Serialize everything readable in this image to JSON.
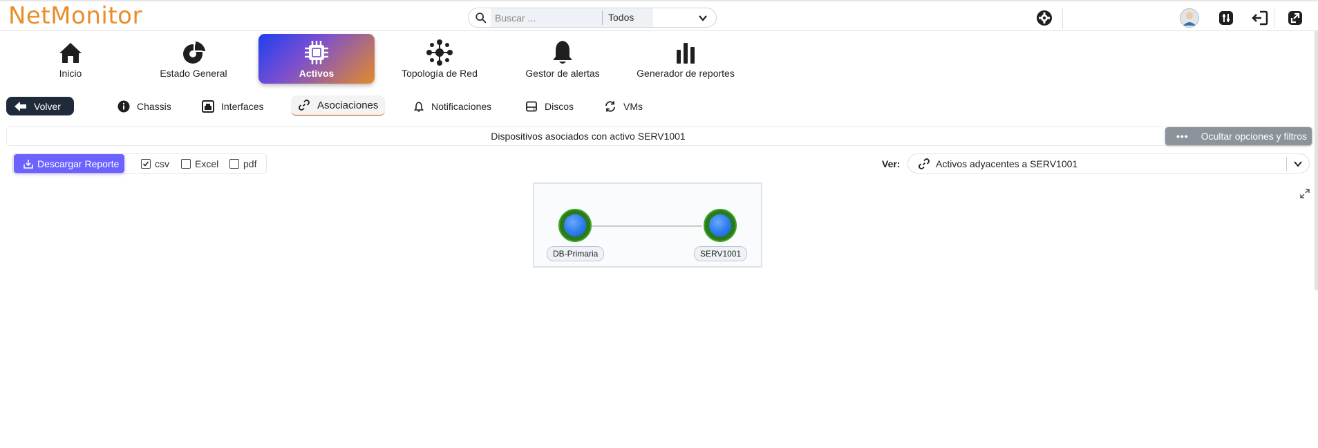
{
  "app": {
    "logo": "NetMonitor"
  },
  "search": {
    "placeholder": "Buscar ...",
    "scope": "Todos"
  },
  "nav": [
    {
      "label": "Inicio",
      "icon": "home-icon"
    },
    {
      "label": "Estado General",
      "icon": "pie-chart-icon"
    },
    {
      "label": "Activos",
      "icon": "chip-icon",
      "active": true
    },
    {
      "label": "Topología de Red",
      "icon": "network-icon"
    },
    {
      "label": "Gestor de alertas",
      "icon": "bell-icon"
    },
    {
      "label": "Generador de reportes",
      "icon": "bar-chart-icon"
    }
  ],
  "subnav": {
    "back_label": "Volver",
    "tabs": [
      "Chassis",
      "Interfaces",
      "Asociaciones",
      "Notificaciones",
      "Discos",
      "VMs"
    ],
    "active_tab": "Asociaciones"
  },
  "panel": {
    "title": "Dispositivos asociados con activo SERV1001",
    "toggle_label": "Ocultar opciones y filtros"
  },
  "report": {
    "button_label": "Descargar Reporte",
    "formats": [
      {
        "label": "csv",
        "checked": true
      },
      {
        "label": "Excel",
        "checked": false
      },
      {
        "label": "pdf",
        "checked": false
      }
    ]
  },
  "view": {
    "label": "Ver:",
    "selected": "Activos adyacentes a SERV1001"
  },
  "graph": {
    "nodes": [
      "DB-Primaria",
      "SERV1001"
    ],
    "edges": [
      [
        "DB-Primaria",
        "SERV1001"
      ]
    ]
  },
  "colors": {
    "accent_orange": "#e88d2a",
    "primary_purple": "#6c63ff",
    "dark_button": "#1f2b3a",
    "node_green": "#3da52a",
    "node_blue": "#2b7cf0"
  }
}
